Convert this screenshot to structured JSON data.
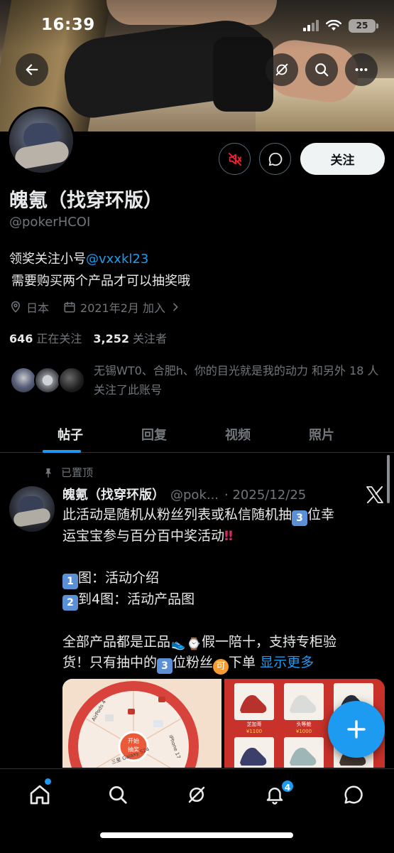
{
  "status_bar": {
    "time": "16:39",
    "battery": "25"
  },
  "profile": {
    "name": "魄氪（找穿环版）",
    "handle": "@pokerHCOI",
    "bio_line1_prefix": "领奖关注小号",
    "bio_line1_mention": "@vxxkl23",
    "bio_line2": "需要购买两个产品才可以抽奖哦",
    "location": "日本",
    "joined": "2021年2月 加入",
    "following_count": "646",
    "following_label": "正在关注",
    "followers_count": "3,252",
    "followers_label": "关注者",
    "followed_by_text": "无锡WT0、合肥h、你的目光就是我的动力 和另外 18 人关注了此账号",
    "follow_button": "关注"
  },
  "tabs": [
    {
      "label": "帖子",
      "active": true
    },
    {
      "label": "回复",
      "active": false
    },
    {
      "label": "视频",
      "active": false
    },
    {
      "label": "照片",
      "active": false
    }
  ],
  "post": {
    "pinned_label": "已置顶",
    "author_name": "魄氪（找穿环版）",
    "author_handle": "@pok...",
    "date": "· 2025/12/25",
    "line1": "此活动是随机从粉丝列表或私信随机抽",
    "line1_num": "3",
    "line1_tail": "位幸",
    "line2": "运宝宝参与百分百中奖活动",
    "line3_num": "1",
    "line3": "图：活动介绍",
    "line4_num": "2",
    "line4": "到4图：活动产品图",
    "line5_head": "全部产品都是正品",
    "line5_tail": "假一陪十，支持专柜验",
    "line6_head": "货！只有抽中的",
    "line6_num": "3",
    "line6_mid": "位粉丝",
    "line6_emoji": "可",
    "line6_tail": "下单",
    "show_more": "显示更多",
    "image1_labels": [
      "开始",
      "抽奖",
      "AirPods 4",
      "三星 Galaxy S24",
      "iPhone 17"
    ],
    "image2_labels": [
      "芝加哥",
      "¥1100",
      "头等舱",
      "¥1000"
    ]
  },
  "nav": {
    "notifications_badge": "4"
  },
  "colors": {
    "accent": "#1d9bf0",
    "mute_red": "#f4212e"
  }
}
